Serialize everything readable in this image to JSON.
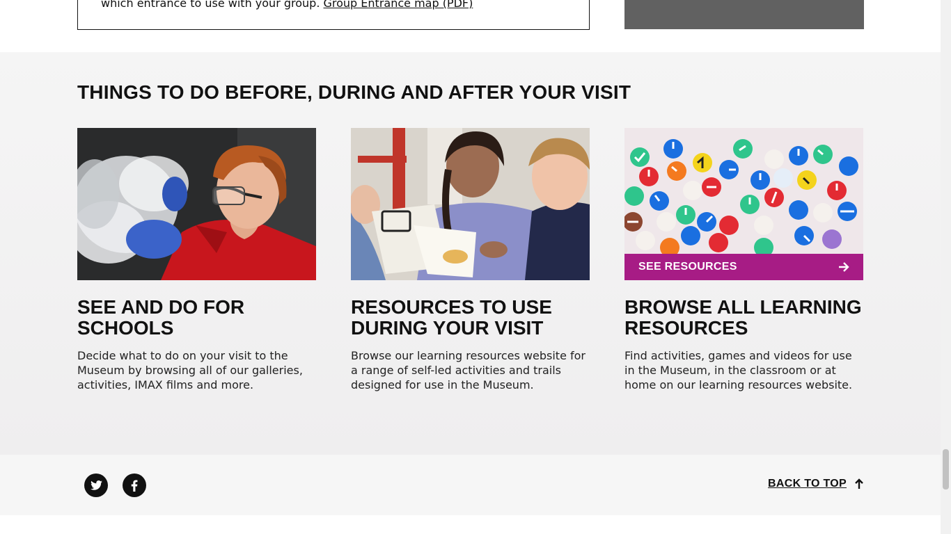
{
  "top": {
    "info_text": "which entrance to use with your group. ",
    "info_link": "Group Entrance map (PDF)"
  },
  "things": {
    "title": "THINGS TO DO BEFORE, DURING AND AFTER YOUR VISIT",
    "cards": [
      {
        "title": "SEE AND DO FOR SCHOOLS",
        "desc": "Decide what to do on your visit to the Museum by browsing all of our galleries, activities, IMAX films and more."
      },
      {
        "title": "RESOURCES TO USE DURING YOUR VISIT",
        "desc": "Browse our learning resources website for a range of self-led activities and trails designed for use in the Museum."
      },
      {
        "title": "BROWSE ALL LEARNING RESOURCES",
        "desc": "Find activities, games and videos for use in the Museum, in the classroom or at home on our learning resources website.",
        "cta": "SEE RESOURCES",
        "cta_icon": "arrow-right-icon"
      }
    ]
  },
  "footer": {
    "social": [
      {
        "name": "twitter",
        "icon": "twitter-icon"
      },
      {
        "name": "facebook",
        "icon": "facebook-icon"
      }
    ],
    "back_to_top": "BACK TO TOP",
    "back_icon": "arrow-up-icon"
  },
  "colors": {
    "accent": "#a71c85",
    "text": "#111111",
    "section_bg": "#f3f3f3"
  }
}
